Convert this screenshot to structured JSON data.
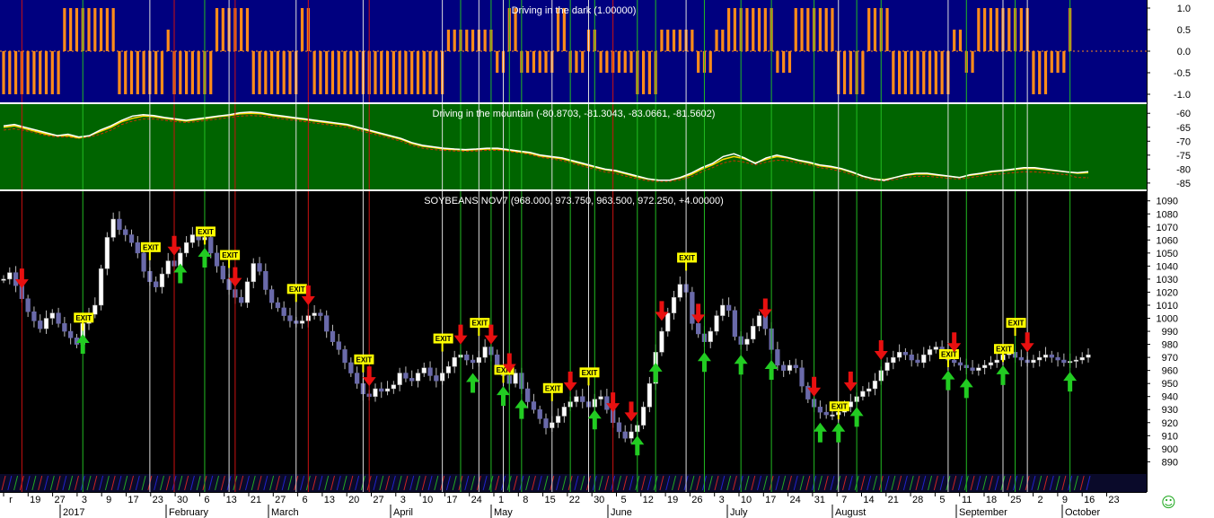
{
  "icons": {
    "status": "smiley-icon",
    "status_glyph": "☺",
    "status_color": "#22aa22"
  },
  "colors": {
    "top_bg": "#00007f",
    "mid_bg": "#006400",
    "main_bg": "#000000",
    "osc": "#ff8c1a",
    "line_white": "#ffffff",
    "line_yellow": "#ffd700",
    "line_red": "#cc3300",
    "candle_up": "#ffffff",
    "candle_down": "#6a6aaa",
    "wick": "#bbbbbb",
    "sell": "#e81010",
    "buy": "#22cc22",
    "exit_bg": "#ffff00",
    "vline_red": "#cc1111",
    "vline_green": "#22bb22",
    "vline_white": "#dddddd"
  },
  "chart_data": [
    {
      "type": "bar",
      "title": "Driving in the dark (1.00000)",
      "ylim": [
        -1.0,
        1.0
      ],
      "yticks": [
        "1.0",
        "0.5",
        "0.0",
        "-0.5",
        "-1.0"
      ],
      "segments": [
        {
          "from": 0,
          "to": 9,
          "value": -1
        },
        {
          "from": 10,
          "to": 18,
          "value": 1
        },
        {
          "from": 19,
          "to": 26,
          "value": -1
        },
        {
          "from": 27,
          "to": 27,
          "value": 0.5
        },
        {
          "from": 28,
          "to": 34,
          "value": -1
        },
        {
          "from": 35,
          "to": 40,
          "value": 1
        },
        {
          "from": 41,
          "to": 48,
          "value": -1
        },
        {
          "from": 49,
          "to": 50,
          "value": 1
        },
        {
          "from": 51,
          "to": 72,
          "value": -1
        },
        {
          "from": 73,
          "to": 80,
          "value": 0.5
        },
        {
          "from": 81,
          "to": 82,
          "value": -0.5
        },
        {
          "from": 83,
          "to": 84,
          "value": 1
        },
        {
          "from": 85,
          "to": 90,
          "value": -0.5
        },
        {
          "from": 91,
          "to": 92,
          "value": 1
        },
        {
          "from": 93,
          "to": 95,
          "value": -0.5
        },
        {
          "from": 96,
          "to": 97,
          "value": 0.5
        },
        {
          "from": 98,
          "to": 103,
          "value": -0.5
        },
        {
          "from": 104,
          "to": 107,
          "value": -1
        },
        {
          "from": 108,
          "to": 113,
          "value": 0.5
        },
        {
          "from": 114,
          "to": 116,
          "value": -0.5
        },
        {
          "from": 117,
          "to": 118,
          "value": 0.5
        },
        {
          "from": 119,
          "to": 126,
          "value": 1
        },
        {
          "from": 127,
          "to": 129,
          "value": -0.5
        },
        {
          "from": 130,
          "to": 136,
          "value": 1
        },
        {
          "from": 137,
          "to": 141,
          "value": -1
        },
        {
          "from": 142,
          "to": 145,
          "value": 1
        },
        {
          "from": 146,
          "to": 155,
          "value": -1
        },
        {
          "from": 156,
          "to": 157,
          "value": 0.5
        },
        {
          "from": 158,
          "to": 159,
          "value": -0.5
        },
        {
          "from": 160,
          "to": 168,
          "value": 1
        },
        {
          "from": 169,
          "to": 171,
          "value": -1
        },
        {
          "from": 172,
          "to": 174,
          "value": -0.5
        },
        {
          "from": 175,
          "to": 175,
          "value": 1
        }
      ]
    },
    {
      "type": "line",
      "title": "Driving in the mountain (-80.8703, -81.3043, -83.0661, -81.5602)",
      "ylim": [
        -86,
        -58
      ],
      "yticks": [
        "-60",
        "-65",
        "-70",
        "-75",
        "-80",
        "-85"
      ],
      "series": [
        {
          "color": "#ffffff",
          "values": [
            -64.5,
            -64.0,
            -65.0,
            -66.0,
            -67.0,
            -68.0,
            -67.5,
            -68.5,
            -68.0,
            -66.0,
            -64.5,
            -62.5,
            -61.0,
            -60.5,
            -60.8,
            -61.5,
            -62.0,
            -62.5,
            -62.0,
            -61.5,
            -61.0,
            -60.5,
            -59.8,
            -59.5,
            -59.8,
            -60.5,
            -61.0,
            -61.5,
            -62.0,
            -62.5,
            -63.0,
            -63.5,
            -64.0,
            -65.0,
            -66.0,
            -67.0,
            -68.0,
            -69.0,
            -70.5,
            -71.5,
            -72.0,
            -72.5,
            -72.8,
            -73.0,
            -72.8,
            -72.5,
            -72.5,
            -73.0,
            -73.5,
            -74.0,
            -75.0,
            -75.5,
            -76.0,
            -77.0,
            -78.0,
            -79.0,
            -80.0,
            -80.5,
            -81.5,
            -82.5,
            -83.5,
            -84.0,
            -84.0,
            -83.0,
            -81.5,
            -79.5,
            -78.0,
            -75.5,
            -74.5,
            -76.0,
            -78.0,
            -76.0,
            -75.0,
            -75.8,
            -76.8,
            -77.5,
            -78.5,
            -79.0,
            -79.8,
            -81.0,
            -82.5,
            -83.5,
            -84.0,
            -83.0,
            -82.0,
            -81.5,
            -81.5,
            -82.0,
            -82.5,
            -83.0,
            -82.0,
            -81.5,
            -80.8,
            -80.5,
            -80.0,
            -79.5,
            -79.5,
            -80.0,
            -80.5,
            -81.0,
            -81.3,
            -80.9
          ]
        },
        {
          "color": "#ffd700",
          "values": [
            -65.0,
            -64.5,
            -65.5,
            -66.5,
            -67.5,
            -68.0,
            -68.0,
            -68.8,
            -68.0,
            -66.5,
            -65.0,
            -63.0,
            -61.8,
            -61.0,
            -61.2,
            -61.8,
            -62.3,
            -62.8,
            -62.3,
            -61.8,
            -61.2,
            -60.8,
            -60.2,
            -60.0,
            -60.2,
            -60.8,
            -61.3,
            -61.8,
            -62.3,
            -62.8,
            -63.3,
            -63.8,
            -64.3,
            -65.3,
            -66.3,
            -67.3,
            -68.3,
            -69.3,
            -70.8,
            -71.8,
            -72.3,
            -72.8,
            -73.0,
            -73.2,
            -73.0,
            -72.8,
            -72.8,
            -73.2,
            -73.8,
            -74.3,
            -75.3,
            -75.8,
            -76.3,
            -77.3,
            -78.3,
            -79.3,
            -80.2,
            -80.8,
            -81.8,
            -82.8,
            -83.6,
            -84.0,
            -84.0,
            -83.2,
            -82.0,
            -80.0,
            -78.5,
            -76.5,
            -75.5,
            -76.3,
            -77.8,
            -76.5,
            -75.5,
            -76.0,
            -77.0,
            -77.8,
            -78.8,
            -79.3,
            -80.0,
            -81.2,
            -82.6,
            -83.5,
            -83.8,
            -83.0,
            -82.2,
            -81.8,
            -81.8,
            -82.2,
            -82.6,
            -83.0,
            -82.2,
            -81.7,
            -81.0,
            -80.6,
            -80.2,
            -79.8,
            -79.8,
            -80.2,
            -80.6,
            -81.0,
            -81.5,
            -81.3
          ]
        },
        {
          "color": "#cc3300",
          "values": [
            -66.0,
            -65.5,
            -66.2,
            -67.0,
            -68.0,
            -68.5,
            -68.5,
            -69.0,
            -68.5,
            -67.5,
            -66.0,
            -64.0,
            -62.8,
            -62.0,
            -62.0,
            -62.5,
            -63.0,
            -63.3,
            -63.0,
            -62.5,
            -62.0,
            -61.5,
            -61.0,
            -60.8,
            -61.0,
            -61.5,
            -62.0,
            -62.5,
            -63.0,
            -63.5,
            -64.0,
            -64.5,
            -65.0,
            -66.0,
            -67.0,
            -68.0,
            -69.0,
            -70.0,
            -71.5,
            -72.5,
            -73.0,
            -73.3,
            -73.5,
            -73.6,
            -73.5,
            -73.3,
            -73.3,
            -73.6,
            -74.2,
            -74.8,
            -75.8,
            -76.3,
            -77.0,
            -78.0,
            -79.0,
            -80.0,
            -81.0,
            -81.6,
            -82.6,
            -83.5,
            -84.2,
            -84.5,
            -84.5,
            -83.8,
            -82.8,
            -81.0,
            -79.5,
            -77.8,
            -77.0,
            -77.5,
            -78.5,
            -77.5,
            -76.8,
            -77.0,
            -77.8,
            -78.5,
            -79.5,
            -80.0,
            -80.8,
            -82.0,
            -83.2,
            -84.0,
            -84.3,
            -83.7,
            -83.0,
            -82.6,
            -82.6,
            -82.9,
            -83.3,
            -83.6,
            -83.0,
            -82.5,
            -82.0,
            -81.7,
            -81.3,
            -81.0,
            -81.0,
            -81.3,
            -81.7,
            -82.0,
            -83.0,
            -83.1
          ]
        }
      ]
    },
    {
      "type": "line",
      "title": "SOYBEANS NOV7 (968.000, 973.750, 963.500, 972.250, +4.00000)",
      "ylim": [
        882,
        1096
      ],
      "yticks": [
        "1090",
        "1080",
        "1070",
        "1060",
        "1050",
        "1040",
        "1030",
        "1020",
        "1010",
        "1000",
        "990",
        "980",
        "970",
        "960",
        "950",
        "940",
        "930",
        "920",
        "910",
        "900",
        "890"
      ],
      "x_labels": [
        "r",
        "19",
        "27",
        "3",
        "9",
        "17",
        "23",
        "30",
        "6",
        "13",
        "21",
        "27",
        "6",
        "13",
        "20",
        "27",
        "3",
        "10",
        "17",
        "24",
        "1",
        "8",
        "15",
        "22",
        "30",
        "5",
        "12",
        "19",
        "26",
        "3",
        "10",
        "17",
        "24",
        "31",
        "7",
        "14",
        "21",
        "28",
        "5",
        "11",
        "18",
        "25",
        "2",
        "9",
        "16",
        "23"
      ],
      "month_labels": [
        "2017",
        "February",
        "March",
        "April",
        "May",
        "June",
        "July",
        "August",
        "September",
        "October"
      ],
      "values": [
        1030,
        1035,
        1025,
        1015,
        1005,
        998,
        992,
        1000,
        1004,
        996,
        990,
        985,
        980,
        996,
        1003,
        1010,
        1038,
        1062,
        1076,
        1068,
        1064,
        1058,
        1050,
        1036,
        1028,
        1024,
        1034,
        1044,
        1040,
        1050,
        1058,
        1064,
        1060,
        1062,
        1050,
        1040,
        1030,
        1022,
        1016,
        1012,
        1028,
        1042,
        1036,
        1022,
        1012,
        1008,
        1002,
        998,
        996,
        998,
        1002,
        1004,
        1002,
        990,
        982,
        976,
        966,
        958,
        950,
        942,
        940,
        946,
        944,
        946,
        949,
        958,
        954,
        952,
        958,
        962,
        956,
        952,
        958,
        963,
        970,
        972,
        968,
        966,
        970,
        978,
        972,
        962,
        956,
        950,
        958,
        946,
        936,
        930,
        923,
        916,
        920,
        925,
        932,
        936,
        940,
        936,
        932,
        938,
        940,
        930,
        920,
        913,
        908,
        913,
        918,
        932,
        950,
        974,
        990,
        1004,
        1016,
        1026,
        1020,
        996,
        988,
        982,
        990,
        1002,
        1010,
        1006,
        986,
        980,
        984,
        994,
        1002,
        992,
        976,
        964,
        960,
        964,
        962,
        948,
        938,
        932,
        928,
        926,
        926,
        928,
        932,
        936,
        940,
        944,
        946,
        952,
        960,
        966,
        970,
        974,
        972,
        968,
        966,
        972,
        976,
        978,
        976,
        968,
        966,
        964,
        962,
        960,
        962,
        964,
        966,
        968,
        972,
        974,
        970,
        968,
        966,
        968,
        970,
        972,
        970,
        968,
        966,
        967,
        968,
        970,
        972
      ],
      "markers": [
        {
          "i": 3,
          "kind": "sell"
        },
        {
          "i": 13,
          "kind": "buy",
          "exit": "EXIT"
        },
        {
          "i": 24,
          "kind": "exit",
          "exit": "EXIT"
        },
        {
          "i": 28,
          "kind": "sell"
        },
        {
          "i": 29,
          "kind": "buy"
        },
        {
          "i": 33,
          "kind": "buy",
          "exit": "EXIT"
        },
        {
          "i": 37,
          "kind": "exit",
          "exit": "EXIT"
        },
        {
          "i": 38,
          "kind": "sell"
        },
        {
          "i": 48,
          "kind": "exit",
          "exit": "EXIT"
        },
        {
          "i": 50,
          "kind": "sell"
        },
        {
          "i": 59,
          "kind": "exit",
          "exit": "EXIT"
        },
        {
          "i": 60,
          "kind": "sell"
        },
        {
          "i": 72,
          "kind": "exit",
          "exit": "EXIT"
        },
        {
          "i": 75,
          "kind": "sell"
        },
        {
          "i": 77,
          "kind": "buy"
        },
        {
          "i": 78,
          "kind": "exit",
          "exit": "EXIT"
        },
        {
          "i": 80,
          "kind": "sell"
        },
        {
          "i": 82,
          "kind": "buy",
          "exit": "EXIT"
        },
        {
          "i": 83,
          "kind": "sell"
        },
        {
          "i": 85,
          "kind": "buy"
        },
        {
          "i": 90,
          "kind": "exit",
          "exit": "EXIT"
        },
        {
          "i": 93,
          "kind": "sell"
        },
        {
          "i": 96,
          "kind": "exit",
          "exit": "EXIT"
        },
        {
          "i": 97,
          "kind": "buy"
        },
        {
          "i": 100,
          "kind": "sell"
        },
        {
          "i": 103,
          "kind": "sell"
        },
        {
          "i": 104,
          "kind": "buy"
        },
        {
          "i": 107,
          "kind": "buy"
        },
        {
          "i": 108,
          "kind": "sell"
        },
        {
          "i": 112,
          "kind": "exit",
          "exit": "EXIT"
        },
        {
          "i": 114,
          "kind": "sell"
        },
        {
          "i": 115,
          "kind": "buy"
        },
        {
          "i": 121,
          "kind": "buy"
        },
        {
          "i": 125,
          "kind": "sell"
        },
        {
          "i": 126,
          "kind": "buy"
        },
        {
          "i": 133,
          "kind": "sell"
        },
        {
          "i": 134,
          "kind": "buy"
        },
        {
          "i": 137,
          "kind": "buy",
          "exit": "EXIT"
        },
        {
          "i": 139,
          "kind": "sell"
        },
        {
          "i": 140,
          "kind": "buy"
        },
        {
          "i": 144,
          "kind": "sell"
        },
        {
          "i": 155,
          "kind": "buy",
          "exit": "EXIT"
        },
        {
          "i": 156,
          "kind": "sell"
        },
        {
          "i": 158,
          "kind": "buy"
        },
        {
          "i": 164,
          "kind": "buy",
          "exit": "EXIT"
        },
        {
          "i": 166,
          "kind": "exit",
          "exit": "EXIT"
        },
        {
          "i": 168,
          "kind": "sell"
        },
        {
          "i": 175,
          "kind": "buy"
        }
      ],
      "vlines": [
        {
          "i": 3,
          "c": "red"
        },
        {
          "i": 13,
          "c": "green"
        },
        {
          "i": 24,
          "c": "white"
        },
        {
          "i": 28,
          "c": "red"
        },
        {
          "i": 33,
          "c": "green"
        },
        {
          "i": 37,
          "c": "white"
        },
        {
          "i": 38,
          "c": "red"
        },
        {
          "i": 48,
          "c": "white"
        },
        {
          "i": 50,
          "c": "red"
        },
        {
          "i": 59,
          "c": "white"
        },
        {
          "i": 60,
          "c": "red"
        },
        {
          "i": 72,
          "c": "white"
        },
        {
          "i": 75,
          "c": "green"
        },
        {
          "i": 78,
          "c": "white"
        },
        {
          "i": 80,
          "c": "green"
        },
        {
          "i": 82,
          "c": "white"
        },
        {
          "i": 83,
          "c": "green"
        },
        {
          "i": 85,
          "c": "green"
        },
        {
          "i": 90,
          "c": "white"
        },
        {
          "i": 93,
          "c": "green"
        },
        {
          "i": 96,
          "c": "white"
        },
        {
          "i": 97,
          "c": "green"
        },
        {
          "i": 100,
          "c": "red"
        },
        {
          "i": 104,
          "c": "green"
        },
        {
          "i": 107,
          "c": "green"
        },
        {
          "i": 112,
          "c": "white"
        },
        {
          "i": 115,
          "c": "green"
        },
        {
          "i": 121,
          "c": "green"
        },
        {
          "i": 126,
          "c": "green"
        },
        {
          "i": 133,
          "c": "green"
        },
        {
          "i": 137,
          "c": "white"
        },
        {
          "i": 140,
          "c": "green"
        },
        {
          "i": 144,
          "c": "green"
        },
        {
          "i": 155,
          "c": "white"
        },
        {
          "i": 158,
          "c": "green"
        },
        {
          "i": 164,
          "c": "white"
        },
        {
          "i": 166,
          "c": "green"
        },
        {
          "i": 168,
          "c": "white"
        },
        {
          "i": 175,
          "c": "green"
        }
      ]
    }
  ]
}
